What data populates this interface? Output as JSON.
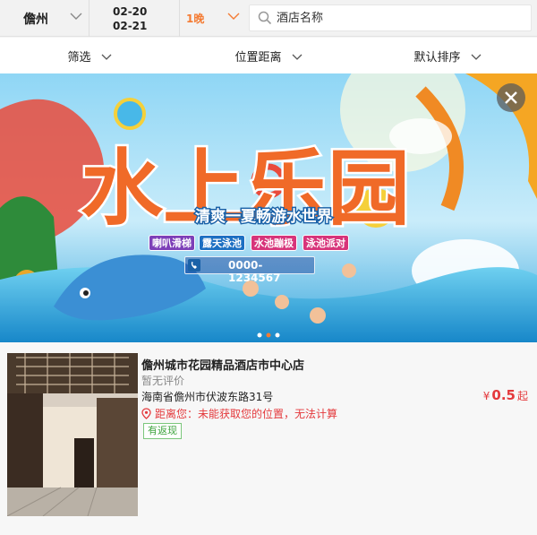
{
  "search_bar": {
    "city": "儋州",
    "checkin_date": "02-20",
    "checkout_date": "02-21",
    "nights": "1晚",
    "search_placeholder": "酒店名称"
  },
  "filters": [
    {
      "label": "筛选"
    },
    {
      "label": "位置距离"
    },
    {
      "label": "默认排序"
    }
  ],
  "banner": {
    "title": "水上乐园",
    "slogan": "清爽一夏畅游水世界",
    "tags": [
      "喇叭滑梯",
      "露天泳池",
      "水池蹦极",
      "泳池派对"
    ],
    "phone": "0000-1234567"
  },
  "hotel": {
    "name": "儋州城市花园精品酒店市中心店",
    "rating": "暂无评价",
    "address": "海南省儋州市伏波东路31号",
    "distance": "距离您：未能获取您的位置，无法计算",
    "badge": "有返现",
    "price_currency": "¥",
    "price_value": "0.5",
    "price_suffix": "起"
  },
  "colors": {
    "accent_orange": "#f47b33",
    "price_red": "#e4393c",
    "badge_green": "#3ea33e"
  }
}
